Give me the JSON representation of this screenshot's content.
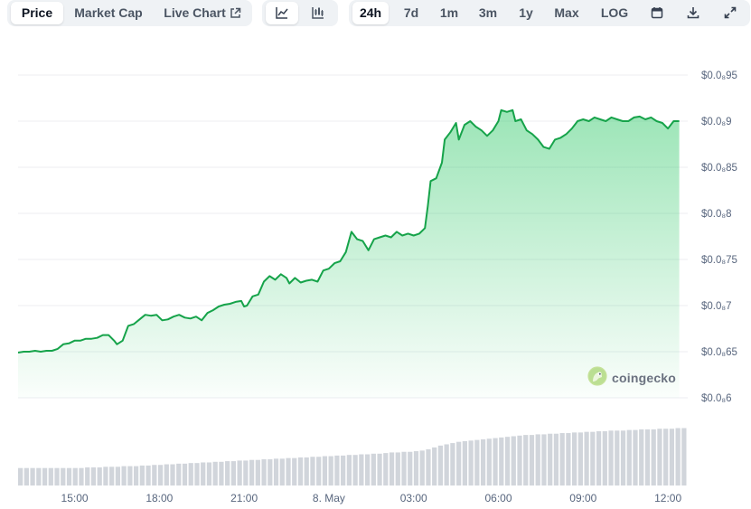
{
  "toolbar": {
    "view_tabs": [
      {
        "label": "Price",
        "active": true
      },
      {
        "label": "Market Cap",
        "active": false
      },
      {
        "label": "Live Chart",
        "active": false
      }
    ],
    "chart_type_buttons": [
      {
        "icon": "line-chart-icon",
        "active": true
      },
      {
        "icon": "candlestick-chart-icon",
        "active": false
      }
    ],
    "range_buttons": [
      {
        "label": "24h",
        "active": true
      },
      {
        "label": "7d",
        "active": false
      },
      {
        "label": "1m",
        "active": false
      },
      {
        "label": "3m",
        "active": false
      },
      {
        "label": "1y",
        "active": false
      },
      {
        "label": "Max",
        "active": false
      },
      {
        "label": "LOG",
        "active": false
      }
    ],
    "tool_icons": [
      "calendar-icon",
      "download-icon",
      "fullscreen-icon"
    ]
  },
  "watermark": {
    "text": "coingecko"
  },
  "colors": {
    "line": "#16a34a",
    "area": "#22c55e",
    "volume": "#d1d5db",
    "grid": "#eceef2",
    "active_bg": "#ffffff",
    "toolbar_bg": "#eff2f5"
  },
  "chart_data": {
    "type": "area",
    "price_axis": {
      "ticks": [
        {
          "value": 9.5e-09,
          "label": "$0.0₈95"
        },
        {
          "value": 9e-09,
          "label": "$0.0₈9"
        },
        {
          "value": 8.5e-09,
          "label": "$0.0₈85"
        },
        {
          "value": 8e-09,
          "label": "$0.0₈8"
        },
        {
          "value": 7.5e-09,
          "label": "$0.0₈75"
        },
        {
          "value": 7e-09,
          "label": "$0.0₈7"
        },
        {
          "value": 6.5e-09,
          "label": "$0.0₈65"
        },
        {
          "value": 6e-09,
          "label": "$0.0₈6"
        }
      ],
      "ylim_units_e9": [
        6.0,
        9.5
      ]
    },
    "time_axis": {
      "ticks": [
        "15:00",
        "18:00",
        "21:00",
        "8. May",
        "03:00",
        "06:00",
        "09:00",
        "12:00"
      ],
      "xlim_hours": [
        13.0,
        36.7
      ]
    },
    "grid": true,
    "series_price_e9": [
      [
        13.0,
        6.49
      ],
      [
        13.2,
        6.5
      ],
      [
        13.4,
        6.5
      ],
      [
        13.6,
        6.51
      ],
      [
        13.8,
        6.5
      ],
      [
        14.0,
        6.51
      ],
      [
        14.2,
        6.51
      ],
      [
        14.4,
        6.53
      ],
      [
        14.6,
        6.58
      ],
      [
        14.8,
        6.59
      ],
      [
        15.0,
        6.62
      ],
      [
        15.2,
        6.62
      ],
      [
        15.4,
        6.64
      ],
      [
        15.6,
        6.64
      ],
      [
        15.8,
        6.65
      ],
      [
        16.0,
        6.68
      ],
      [
        16.2,
        6.68
      ],
      [
        16.4,
        6.62
      ],
      [
        16.5,
        6.58
      ],
      [
        16.7,
        6.62
      ],
      [
        16.9,
        6.78
      ],
      [
        17.1,
        6.8
      ],
      [
        17.3,
        6.85
      ],
      [
        17.5,
        6.9
      ],
      [
        17.7,
        6.89
      ],
      [
        17.9,
        6.9
      ],
      [
        18.1,
        6.84
      ],
      [
        18.3,
        6.85
      ],
      [
        18.5,
        6.88
      ],
      [
        18.7,
        6.9
      ],
      [
        18.9,
        6.87
      ],
      [
        19.1,
        6.86
      ],
      [
        19.3,
        6.88
      ],
      [
        19.5,
        6.84
      ],
      [
        19.7,
        6.92
      ],
      [
        19.9,
        6.95
      ],
      [
        20.1,
        6.99
      ],
      [
        20.3,
        7.01
      ],
      [
        20.5,
        7.02
      ],
      [
        20.7,
        7.04
      ],
      [
        20.9,
        7.05
      ],
      [
        21.0,
        6.99
      ],
      [
        21.1,
        7.0
      ],
      [
        21.3,
        7.1
      ],
      [
        21.5,
        7.12
      ],
      [
        21.7,
        7.26
      ],
      [
        21.9,
        7.32
      ],
      [
        22.1,
        7.28
      ],
      [
        22.3,
        7.34
      ],
      [
        22.5,
        7.3
      ],
      [
        22.6,
        7.24
      ],
      [
        22.8,
        7.3
      ],
      [
        23.0,
        7.25
      ],
      [
        23.2,
        7.27
      ],
      [
        23.4,
        7.28
      ],
      [
        23.6,
        7.26
      ],
      [
        23.8,
        7.38
      ],
      [
        24.0,
        7.4
      ],
      [
        24.2,
        7.46
      ],
      [
        24.4,
        7.48
      ],
      [
        24.6,
        7.58
      ],
      [
        24.8,
        7.8
      ],
      [
        25.0,
        7.72
      ],
      [
        25.2,
        7.7
      ],
      [
        25.4,
        7.6
      ],
      [
        25.6,
        7.72
      ],
      [
        25.8,
        7.74
      ],
      [
        26.0,
        7.76
      ],
      [
        26.2,
        7.74
      ],
      [
        26.4,
        7.8
      ],
      [
        26.6,
        7.76
      ],
      [
        26.8,
        7.78
      ],
      [
        27.0,
        7.76
      ],
      [
        27.2,
        7.78
      ],
      [
        27.4,
        7.84
      ],
      [
        27.5,
        8.08
      ],
      [
        27.6,
        8.35
      ],
      [
        27.8,
        8.38
      ],
      [
        28.0,
        8.55
      ],
      [
        28.1,
        8.8
      ],
      [
        28.3,
        8.88
      ],
      [
        28.5,
        8.98
      ],
      [
        28.6,
        8.8
      ],
      [
        28.8,
        8.96
      ],
      [
        29.0,
        9.0
      ],
      [
        29.2,
        8.94
      ],
      [
        29.4,
        8.9
      ],
      [
        29.6,
        8.84
      ],
      [
        29.8,
        8.9
      ],
      [
        30.0,
        9.0
      ],
      [
        30.1,
        9.12
      ],
      [
        30.3,
        9.1
      ],
      [
        30.5,
        9.12
      ],
      [
        30.6,
        9.0
      ],
      [
        30.8,
        9.02
      ],
      [
        31.0,
        8.9
      ],
      [
        31.2,
        8.86
      ],
      [
        31.4,
        8.8
      ],
      [
        31.6,
        8.72
      ],
      [
        31.8,
        8.7
      ],
      [
        32.0,
        8.8
      ],
      [
        32.2,
        8.82
      ],
      [
        32.4,
        8.86
      ],
      [
        32.6,
        8.92
      ],
      [
        32.8,
        9.0
      ],
      [
        33.0,
        9.02
      ],
      [
        33.2,
        9.0
      ],
      [
        33.4,
        9.04
      ],
      [
        33.6,
        9.02
      ],
      [
        33.8,
        9.0
      ],
      [
        34.0,
        9.04
      ],
      [
        34.2,
        9.02
      ],
      [
        34.4,
        9.0
      ],
      [
        34.6,
        9.0
      ],
      [
        34.8,
        9.04
      ],
      [
        35.0,
        9.05
      ],
      [
        35.2,
        9.02
      ],
      [
        35.4,
        9.04
      ],
      [
        35.6,
        9.0
      ],
      [
        35.8,
        8.98
      ],
      [
        36.0,
        8.92
      ],
      [
        36.2,
        9.0
      ],
      [
        36.4,
        9.0
      ]
    ],
    "volume_relative": [
      0.28,
      0.28,
      0.28,
      0.28,
      0.28,
      0.28,
      0.28,
      0.28,
      0.28,
      0.28,
      0.28,
      0.29,
      0.29,
      0.29,
      0.3,
      0.3,
      0.3,
      0.31,
      0.31,
      0.31,
      0.32,
      0.32,
      0.33,
      0.33,
      0.34,
      0.34,
      0.35,
      0.35,
      0.36,
      0.36,
      0.37,
      0.37,
      0.38,
      0.38,
      0.39,
      0.39,
      0.4,
      0.4,
      0.41,
      0.41,
      0.42,
      0.42,
      0.43,
      0.43,
      0.44,
      0.44,
      0.45,
      0.45,
      0.46,
      0.46,
      0.47,
      0.47,
      0.48,
      0.48,
      0.49,
      0.49,
      0.5,
      0.5,
      0.51,
      0.51,
      0.52,
      0.53,
      0.53,
      0.54,
      0.54,
      0.55,
      0.56,
      0.58,
      0.61,
      0.64,
      0.66,
      0.68,
      0.7,
      0.71,
      0.72,
      0.73,
      0.74,
      0.75,
      0.76,
      0.77,
      0.78,
      0.79,
      0.8,
      0.81,
      0.81,
      0.82,
      0.82,
      0.83,
      0.83,
      0.84,
      0.84,
      0.85,
      0.85,
      0.86,
      0.86,
      0.87,
      0.87,
      0.88,
      0.88,
      0.88,
      0.89,
      0.89,
      0.9,
      0.9,
      0.9,
      0.91,
      0.91,
      0.91,
      0.92,
      0.92
    ]
  }
}
